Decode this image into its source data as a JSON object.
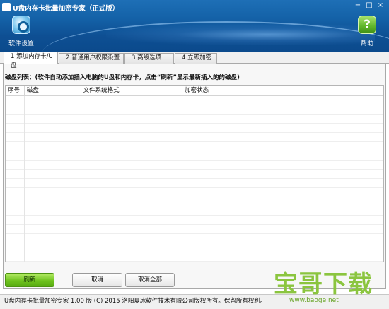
{
  "window": {
    "title": "U盘内存卡批量加密专家（正式版）",
    "controls": [
      "−",
      "□",
      "×"
    ]
  },
  "toolbar": {
    "settings_label": "软件设置",
    "help_label": "帮助",
    "help_glyph": "?"
  },
  "tabs": [
    {
      "label": "1 添加内存卡/U盘",
      "active": true
    },
    {
      "label": "2 普通用户权限设置",
      "active": false
    },
    {
      "label": "3 高级选项",
      "active": false
    },
    {
      "label": "4 立即加密",
      "active": false
    }
  ],
  "disk_list": {
    "description": "磁盘列表：(软件自动添加插入电脑的U盘和内存卡，点击“刷新”显示最新插入的的磁盘)",
    "columns": [
      "序号",
      "磁盘",
      "文件系统格式",
      "加密状态"
    ],
    "rows": []
  },
  "buttons": {
    "refresh": "刷新",
    "cancel": "取消",
    "cancel_all": "取消全部"
  },
  "status_bar": {
    "text": "U盘内存卡批量加密专家 1.00 版  (C)  2015 洛阳夏冰软件技术有限公司版权所有。保留所有权利。"
  },
  "watermark": {
    "text": "宝哥下载",
    "url": "www.baoge.net"
  },
  "colors": {
    "header_blue": "#1462a8",
    "refresh_green": "#6fc31f",
    "watermark_green": "#8bc53f"
  }
}
